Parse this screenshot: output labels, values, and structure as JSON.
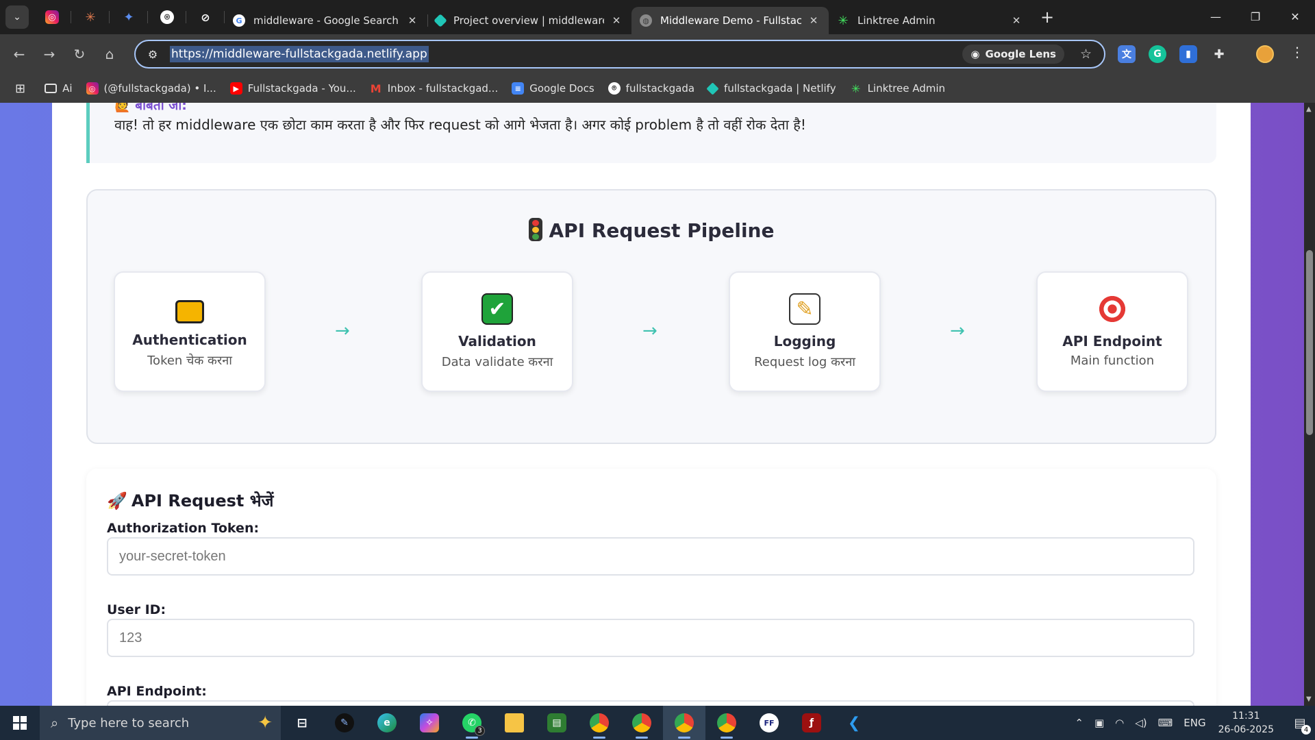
{
  "browser": {
    "tabs": [
      {
        "title": "middleware - Google Search",
        "favicon": "google-icon"
      },
      {
        "title": "Project overview | middleware-f",
        "favicon": "netlify-icon"
      },
      {
        "title": "Middleware Demo - Fullstackga",
        "favicon": "globe-icon",
        "active": true
      },
      {
        "title": "Linktree Admin",
        "favicon": "linktree-icon"
      }
    ],
    "url": "https://middleware-fullstackgada.netlify.app",
    "lens_label": "Google Lens",
    "bookmarks": [
      {
        "label": "Ai",
        "icon": "folder-icon"
      },
      {
        "label": "(@fullstackgada) • I...",
        "icon": "instagram-icon"
      },
      {
        "label": "Fullstackgada - You...",
        "icon": "youtube-icon"
      },
      {
        "label": "Inbox - fullstackgad...",
        "icon": "gmail-icon"
      },
      {
        "label": "Google Docs",
        "icon": "google-docs-icon"
      },
      {
        "label": "fullstackgada",
        "icon": "github-icon"
      },
      {
        "label": "fullstackgada | Netlify",
        "icon": "netlify-icon"
      },
      {
        "label": "Linktree Admin",
        "icon": "linktree-icon"
      }
    ]
  },
  "page": {
    "dialog": {
      "speaker": "🙋 बबिता जी:",
      "text": "वाह! तो हर middleware एक छोटा काम करता है और फिर request को आगे भेजता है। अगर कोई problem है तो वहीं रोक देता है!"
    },
    "pipeline": {
      "title": "API Request Pipeline",
      "title_icon": "traffic-light-icon",
      "arrow": "→",
      "steps": [
        {
          "name": "Authentication",
          "desc": "Token चेक करना",
          "icon": "lock-icon"
        },
        {
          "name": "Validation",
          "desc": "Data validate करना",
          "icon": "check-icon"
        },
        {
          "name": "Logging",
          "desc": "Request log करना",
          "icon": "memo-icon"
        },
        {
          "name": "API Endpoint",
          "desc": "Main function",
          "icon": "target-icon"
        }
      ]
    },
    "form": {
      "title": "API Request भेजें",
      "title_icon": "rocket-icon",
      "fields": [
        {
          "label": "Authorization Token:",
          "placeholder": "your-secret-token"
        },
        {
          "label": "User ID:",
          "placeholder": "123"
        },
        {
          "label": "API Endpoint:",
          "placeholder": ""
        }
      ]
    }
  },
  "taskbar": {
    "search_placeholder": "Type here to search",
    "whatsapp_badge": "3",
    "language": "ENG",
    "time": "11:31",
    "date": "26-06-2025",
    "notification_count": "4"
  }
}
